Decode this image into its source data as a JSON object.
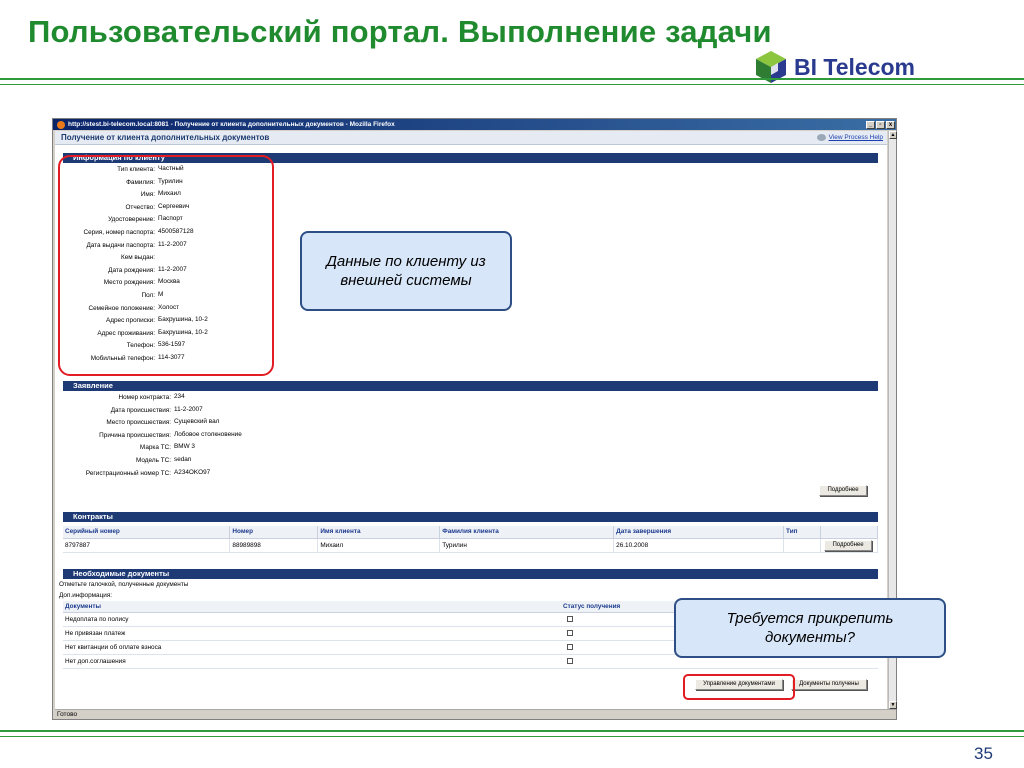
{
  "slide": {
    "title": "Пользовательский портал. Выполнение задачи",
    "page_number": "35",
    "logo_text": "BI Telecom"
  },
  "browser": {
    "title": "http://stest.bi-telecom.local:8081 - Получение от клиента дополнительных документов - Mozilla Firefox",
    "status": "Готово",
    "window_buttons": [
      "_",
      "▫",
      "x"
    ]
  },
  "page": {
    "header": "Получение от клиента дополнительных документов",
    "help_link": "View Process Help"
  },
  "client_info": {
    "section_title": "Информация по клиенту",
    "fields": [
      {
        "label": "Тип клиента:",
        "value": "Частный"
      },
      {
        "label": "Фамилия:",
        "value": "Турилин"
      },
      {
        "label": "Имя:",
        "value": "Михаил"
      },
      {
        "label": "Отчество:",
        "value": "Сергеевич"
      },
      {
        "label": "Удостоверение:",
        "value": "Паспорт"
      },
      {
        "label": "Серия, номер паспорта:",
        "value": "4500587128"
      },
      {
        "label": "Дата выдачи паспорта:",
        "value": "11-2-2007"
      },
      {
        "label": "Кем выдан:",
        "value": ""
      },
      {
        "label": "Дата рождения:",
        "value": "11-2-2007"
      },
      {
        "label": "Место рождения:",
        "value": "Москва"
      },
      {
        "label": "Пол:",
        "value": "М"
      },
      {
        "label": "Семейное положение:",
        "value": "Холост"
      },
      {
        "label": "Адрес прописки:",
        "value": "Бахрушина, 10-2"
      },
      {
        "label": "Адрес проживания:",
        "value": "Бахрушина, 10-2"
      },
      {
        "label": "Телефон:",
        "value": "536-1597"
      },
      {
        "label": "Мобильный телефон:",
        "value": "114-3077"
      }
    ]
  },
  "application": {
    "section_title": "Заявление",
    "fields": [
      {
        "label": "Номер контракта:",
        "value": "234"
      },
      {
        "label": "Дата происшествия:",
        "value": "11-2-2007"
      },
      {
        "label": "Место происшествия:",
        "value": "Сущевский вал"
      },
      {
        "label": "Причина происшествия:",
        "value": "Лобовое столкновение"
      },
      {
        "label": "Марка ТС:",
        "value": "BMW 3"
      },
      {
        "label": "Модель ТС:",
        "value": "sedan"
      },
      {
        "label": "Регистрационный номер ТС:",
        "value": "A234OKO97"
      }
    ],
    "details_button": "Подробнее"
  },
  "contracts": {
    "section_title": "Контракты",
    "columns": [
      "Серийный номер",
      "Номер",
      "Имя клиента",
      "Фамилия клиента",
      "Дата завершения",
      "Тип"
    ],
    "rows": [
      [
        "8797887",
        "88989898",
        "Михаил",
        "Турилин",
        "26.10.2008",
        ""
      ]
    ],
    "details_button": "Подробнее"
  },
  "documents": {
    "section_title": "Необходимые документы",
    "note": "Отметьте галочкой, полученные документы",
    "extra_info_label": "Доп.информация:",
    "columns": [
      "Документы",
      "Статус получения"
    ],
    "rows": [
      {
        "name": "Недоплата по полису",
        "checked": false
      },
      {
        "name": "Не привязан платеж",
        "checked": false
      },
      {
        "name": "Нет квитанции об оплате взноса",
        "checked": false
      },
      {
        "name": "Нет доп.соглашения",
        "checked": false
      }
    ],
    "manage_button": "Управление документами",
    "received_button": "Документы получены"
  },
  "callouts": {
    "client_data": "Данные по клиенту из внешней системы",
    "attach_docs": "Требуется прикрепить документы?"
  },
  "colors": {
    "title_green": "#1f8a2e",
    "section_navy": "#1e3a75",
    "highlight_red": "#e31b23",
    "callout_fill": "#d7e6f8"
  }
}
